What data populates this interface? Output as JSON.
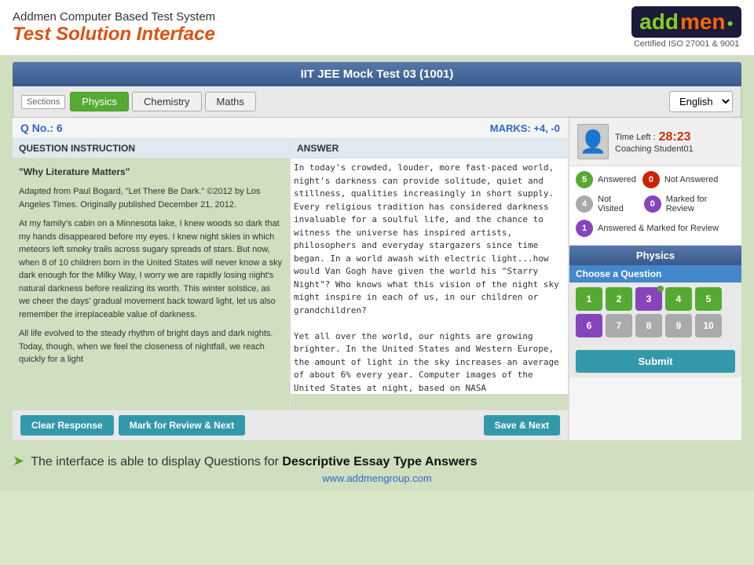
{
  "header": {
    "app_title_small": "Addmen Computer Based Test System",
    "app_title_big": "Test Solution Interface",
    "logo_text_part1": "add",
    "logo_text_part2": "men",
    "certified": "Certified ISO 27001 & 9001"
  },
  "test": {
    "title": "IIT JEE Mock Test 03 (1001)"
  },
  "sections": {
    "label": "Sections",
    "tabs": [
      {
        "label": "Physics",
        "active": true
      },
      {
        "label": "Chemistry",
        "active": false
      },
      {
        "label": "Maths",
        "active": false
      }
    ],
    "language": "English"
  },
  "question": {
    "number": "Q No.: 6",
    "marks": "MARKS: +4, -0",
    "instruction_header": "QUESTION INSTRUCTION",
    "instruction_title": "\"Why Literature Matters\"",
    "instruction_text": "Adapted from Paul Bogard, \"Let There Be Dark.\" ©2012 by Los Angeles Times. Originally published December 21, 2012.\n\nAt my family's cabin on a Minnesota lake, I knew woods so dark that my hands disappeared before my eyes. I knew night skies in which meteors left smoky trails across sugary spreads of stars. But now, when 8 of 10 children born in the United States will never know a sky dark enough for the Milky Way, I worry we are rapidly losing night's natural darkness before realizing its worth. This winter solstice, as we cheer the days' gradual movement back toward light, let us also remember the irreplaceable value of darkness.\n\nAll life evolved to the steady rhythm of bright days and dark nights. Today, though, when we feel the closeness of nightfall, we reach quickly for a light",
    "answer_header": "ANSWER",
    "answer_text": "In today's crowded, louder, more fast-paced world, night's darkness can provide solitude, quiet and stillness, qualities increasingly in short supply. Every religious tradition has considered darkness invaluable for a soulful life, and the chance to witness the universe has inspired artists, philosophers and everyday stargazers since time began. In a world awash with electric light...how would Van Gogh have given the world his \"Starry Night\"? Who knows what this vision of the night sky might inspire in each of us, in our children or grandchildren?\n\nYet all over the world, our nights are growing brighter. In the United States and Western Europe, the amount of light in the sky increases an average of about 6% every year. Computer images of the United States at night, based on NASA"
  },
  "buttons": {
    "clear": "Clear Response",
    "mark_review": "Mark for Review & Next",
    "save_next": "Save & Next",
    "submit": "Submit"
  },
  "legend": {
    "answered": {
      "count": "5",
      "label": "Answered"
    },
    "not_answered": {
      "count": "0",
      "label": "Not Answered"
    },
    "not_visited": {
      "count": "4",
      "label": "Not Visited"
    },
    "marked": {
      "count": "0",
      "label": "Marked for Review"
    },
    "answered_marked": {
      "count": "1",
      "label": "Answered & Marked for Review"
    }
  },
  "right_panel": {
    "time_left_label": "Time Left :",
    "time_value": "28:23",
    "student_name": "Coaching Student01",
    "subject_header": "Physics",
    "choose_q": "Choose a Question",
    "q_numbers": [
      [
        {
          "num": "1",
          "state": "green"
        },
        {
          "num": "2",
          "state": "green"
        },
        {
          "num": "3",
          "state": "purple"
        },
        {
          "num": "4",
          "state": "green"
        },
        {
          "num": "5",
          "state": "green"
        }
      ],
      [
        {
          "num": "6",
          "state": "purple"
        },
        {
          "num": "7",
          "state": "gray"
        },
        {
          "num": "8",
          "state": "gray"
        },
        {
          "num": "9",
          "state": "gray"
        },
        {
          "num": "10",
          "state": "gray"
        }
      ]
    ]
  },
  "footer": {
    "text_prefix": "The interface is able to display Questions for ",
    "text_highlight": "Descriptive Essay Type Answers",
    "url": "www.addmengroup.com"
  }
}
